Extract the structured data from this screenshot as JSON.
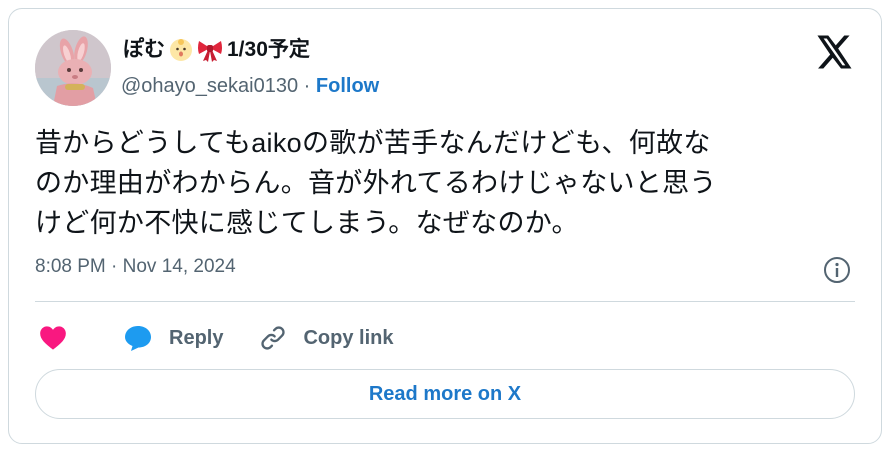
{
  "author": {
    "display_name": "ぽむ",
    "name_suffix": "1/30予定",
    "handle": "@ohayo_sekai0130",
    "separator": "·",
    "follow_label": "Follow"
  },
  "tweet": {
    "text_line_1": "昔からどうしてもaikoの歌が苦手なんだけども、何故な",
    "text_line_2": "のか理由がわからん。音が外れてるわけじゃないと思う",
    "text_line_3": "けど何か不快に感じてしまう。なぜなのか。",
    "timestamp": "8:08 PM · Nov 14, 2024"
  },
  "actions": {
    "reply_label": "Reply",
    "copy_link_label": "Copy link"
  },
  "footer": {
    "read_more_label": "Read more on X"
  },
  "icons": {
    "like": "heart-icon",
    "reply": "speech-bubble-icon",
    "copy": "link-icon",
    "info": "info-icon",
    "brand": "x-logo-icon",
    "emoji_1": "baby-chick-face-emoji",
    "emoji_2": "ribbon-emoji"
  },
  "colors": {
    "heart": "#f91880",
    "reply_bubble": "#1d9bf0",
    "link_blue": "#1d78c9",
    "muted": "#536471",
    "border": "#cfd9de"
  }
}
